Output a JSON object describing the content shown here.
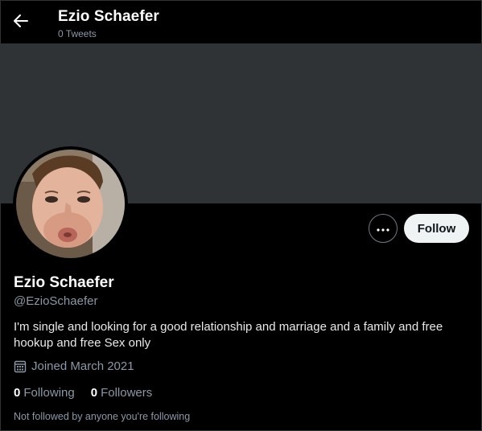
{
  "header": {
    "name": "Ezio Schaefer",
    "tweet_count": "0 Tweets",
    "back_icon": "arrow-left-icon"
  },
  "banner": {
    "color": "#2f3336"
  },
  "avatar": {
    "description_icon": "profile-photo"
  },
  "actions": {
    "more_icon": "more-options-icon",
    "follow_label": "Follow"
  },
  "profile": {
    "name": "Ezio Schaefer",
    "handle": "@EzioSchaefer",
    "bio": "I'm single and looking for a good relationship and marriage and a family and free hookup and free Sex only",
    "joined": "Joined March 2021",
    "joined_icon": "calendar-icon"
  },
  "stats": {
    "following_count": "0",
    "following_label": "Following",
    "followers_count": "0",
    "followers_label": "Followers"
  },
  "mutual_text": "Not followed by anyone you're following",
  "colors": {
    "background": "#000000",
    "text_primary": "#ffffff",
    "text_secondary": "#8b98a5",
    "button_light": "#eff3f4"
  }
}
